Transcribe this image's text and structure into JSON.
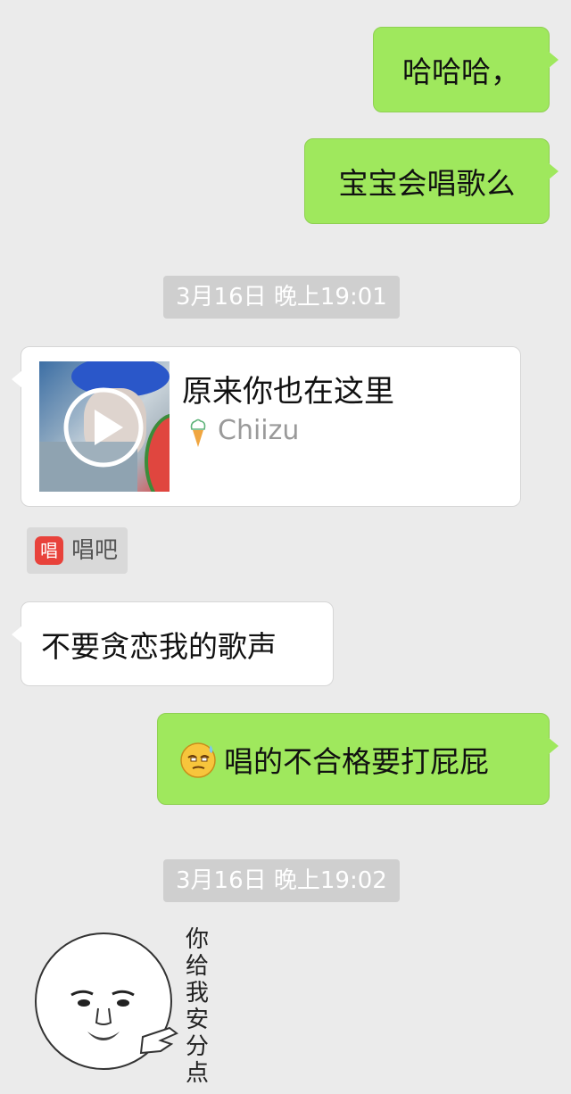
{
  "messages": {
    "m1": "哈哈哈，",
    "m2": "宝宝会唱歌么",
    "timestamp1": "3月16日 晚上19:01",
    "card": {
      "title": "原来你也在这里",
      "artist": "Chiizu"
    },
    "source_app": "唱吧",
    "source_app_icon_glyph": "唱",
    "m3": "不要贪恋我的歌声",
    "m4": "唱的不合格要打屁屁",
    "timestamp2": "3月16日 晚上19:02",
    "sticker_text": "你给我安分点"
  },
  "colors": {
    "outgoing_bubble": "#9fe85d",
    "incoming_bubble": "#ffffff",
    "background": "#ebebeb",
    "timestamp_bg": "#cfcfcf",
    "app_red": "#e8423b"
  },
  "icons": [
    "play-icon",
    "ice-cream-icon",
    "changba-app-icon",
    "sweat-smile-emoji"
  ]
}
